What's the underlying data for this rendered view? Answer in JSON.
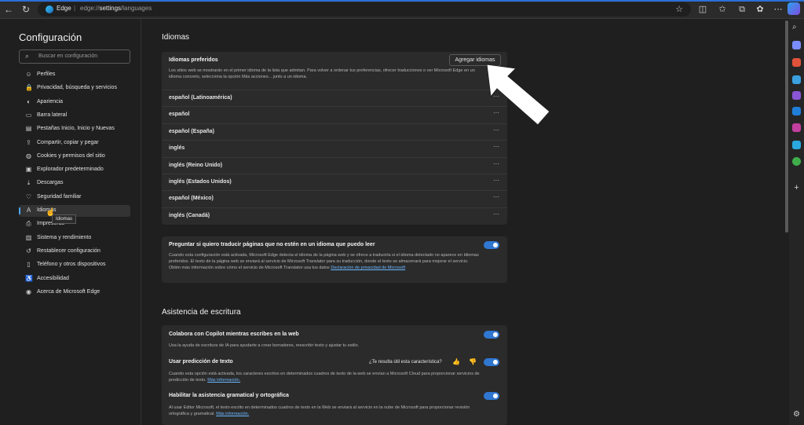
{
  "browser": {
    "brand": "Edge",
    "url_prefix": "edge://",
    "url_bold": "settings",
    "url_rest": "/languages",
    "separator": "|"
  },
  "sidebar": {
    "title": "Configuración",
    "search_placeholder": "Buscar en configuración",
    "items": [
      {
        "label": "Perfiles",
        "icon": "profile-icon"
      },
      {
        "label": "Privacidad, búsqueda y servicios",
        "icon": "lock-icon"
      },
      {
        "label": "Apariencia",
        "icon": "palette-icon"
      },
      {
        "label": "Barra lateral",
        "icon": "sidebar-icon"
      },
      {
        "label": "Pestañas Inicio, Inicio y Nuevas",
        "icon": "tabs-icon"
      },
      {
        "label": "Compartir, copiar y pegar",
        "icon": "share-icon"
      },
      {
        "label": "Cookies y permisos del sitio",
        "icon": "cookie-icon"
      },
      {
        "label": "Explorador predeterminado",
        "icon": "browser-icon"
      },
      {
        "label": "Descargas",
        "icon": "download-icon"
      },
      {
        "label": "Seguridad familiar",
        "icon": "family-icon"
      },
      {
        "label": "Idiomas",
        "icon": "language-icon"
      },
      {
        "label": "Impresoras",
        "icon": "printer-icon"
      },
      {
        "label": "Sistema y rendimiento",
        "icon": "system-icon"
      },
      {
        "label": "Restablecer configuración",
        "icon": "reset-icon"
      },
      {
        "label": "Teléfono y otros dispositivos",
        "icon": "phone-icon"
      },
      {
        "label": "Accesibilidad",
        "icon": "accessibility-icon"
      },
      {
        "label": "Acerca de Microsoft Edge",
        "icon": "edge-icon"
      }
    ],
    "active_index": 10,
    "tooltip": "Idiomas"
  },
  "languages": {
    "heading": "Idiomas",
    "preferred_title": "Idiomas preferidos",
    "add_button": "Agregar idiomas",
    "preferred_desc": "Los sitios web se mostrarán en el primer idioma de la lista que admitan. Para volver a ordenar tus preferencias, ofrecer traducciones o ver Microsoft Edge en un idioma concreto, selecciona la opción Más acciones... junto a un idioma.",
    "list": [
      "español (Latinoamérica)",
      "español",
      "español (España)",
      "inglés",
      "inglés (Reino Unido)",
      "inglés (Estados Unidos)",
      "español (México)",
      "inglés (Canadá)"
    ],
    "more_label": "···",
    "translate_title": "Preguntar si quiero traducir páginas que no estén en un idioma que puedo leer",
    "translate_desc": "Cuando esta configuración está activada, Microsoft Edge detecta el idioma de la página web y se ofrece a traducirla si el idioma detectado no aparece en Idiomas preferidos. El texto de la página web se enviará al servicio de Microsoft Translator para su traducción, donde el texto se almacenará para mejorar el servicio. Obtén más información sobre cómo el servicio de Microsoft Translator usa tus datos",
    "translate_link": "Declaración de privacidad de Microsoft",
    "translate_on": true
  },
  "writing": {
    "heading": "Asistencia de escritura",
    "copilot_title": "Colabora con Copilot mientras escribes en la web",
    "copilot_desc": "Usa la ayuda de escritura de IA para ayudarte a crear borradores, reescribir texto y ajustar tu estilo.",
    "copilot_on": true,
    "prediction_title": "Usar predicción de texto",
    "feedback_question": "¿Te resulta útil esta característica?",
    "prediction_desc": "Cuando esta opción está activada, los caracteres escritos en determinados cuadros de texto de la web se envían a Microsoft Cloud para proporcionar servicios de predicción de texto.",
    "prediction_link": "Más información.",
    "prediction_on": true,
    "grammar_title": "Habilitar la asistencia gramatical y ortográfica",
    "grammar_desc": "Al usar Editor Microsoft, el texto escrito en determinados cuadros de texto en la Web se enviará al servicio en la nube de Microsoft para proporcionar revisión ortográfica y gramatical.",
    "grammar_link": "Más información.",
    "grammar_on": true
  }
}
